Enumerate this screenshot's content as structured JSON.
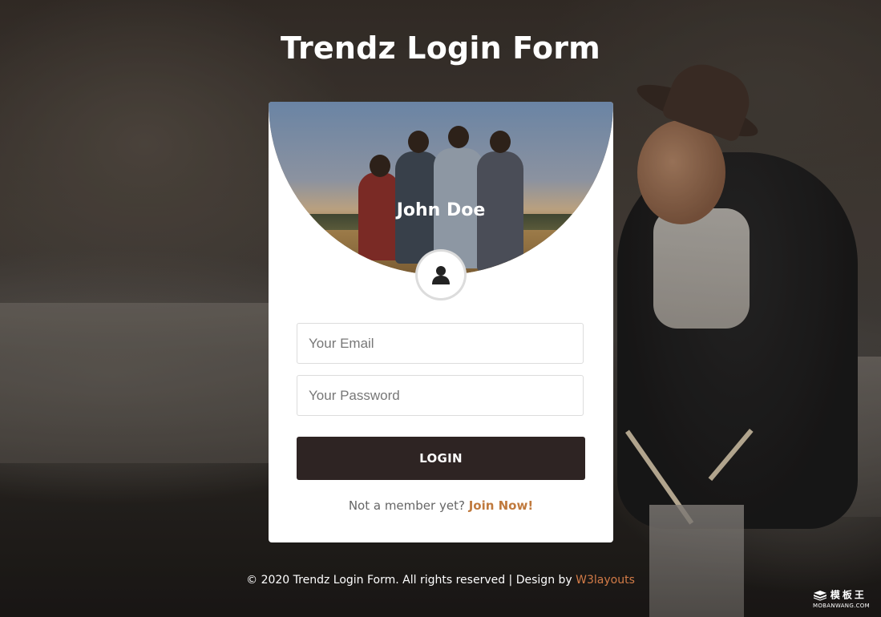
{
  "page": {
    "title": "Trendz Login Form"
  },
  "card": {
    "name": "John Doe",
    "avatar_icon": "user-icon"
  },
  "form": {
    "email_placeholder": "Your Email",
    "password_placeholder": "Your Password",
    "login_label": "LOGIN",
    "member_text": "Not a member yet?",
    "join_label": "Join Now!"
  },
  "footer": {
    "copyright": "© 2020 Trendz Login Form. All rights reserved | Design by",
    "credit_link": "W3layouts"
  },
  "watermark": {
    "brand": "模板王",
    "url": "MOBANWANG.COM"
  },
  "colors": {
    "button_bg": "#2e2423",
    "link_accent": "#c07a3e",
    "footer_link": "#d27b47"
  }
}
